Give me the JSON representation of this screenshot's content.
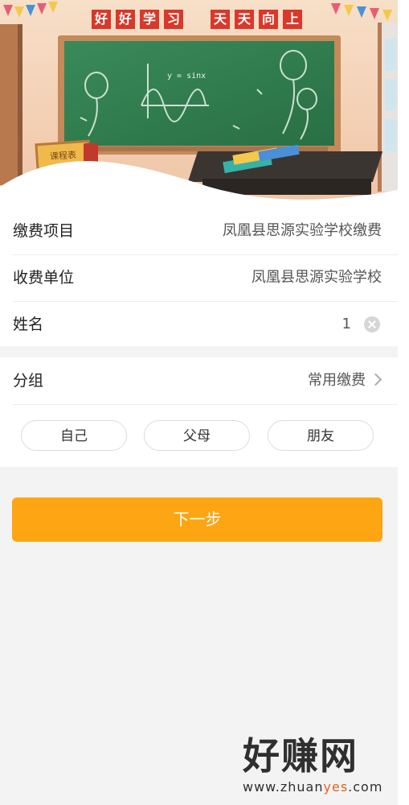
{
  "banner": {
    "slogan_chars": [
      "好",
      "好",
      "学",
      "习",
      "天",
      "天",
      "向",
      "上"
    ],
    "schedule_label": "课程表",
    "formula": "y = sinx"
  },
  "form": {
    "item_label": "缴费项目",
    "item_value": "凤凰县思源实验学校缴费",
    "unit_label": "收费单位",
    "unit_value": "凤凰县思源实验学校",
    "name_label": "姓名",
    "name_value": "1"
  },
  "group": {
    "label": "分组",
    "value": "常用缴费",
    "chips": [
      "自己",
      "父母",
      "朋友"
    ]
  },
  "next_button": "下一步",
  "watermark": {
    "main": "好赚网",
    "url_a": "www.zhuan",
    "url_hl": "yes",
    "url_b": ".com"
  },
  "colors": {
    "accent": "#fda512",
    "board": "#2f7a4c",
    "slogan_box": "#d9382b"
  }
}
